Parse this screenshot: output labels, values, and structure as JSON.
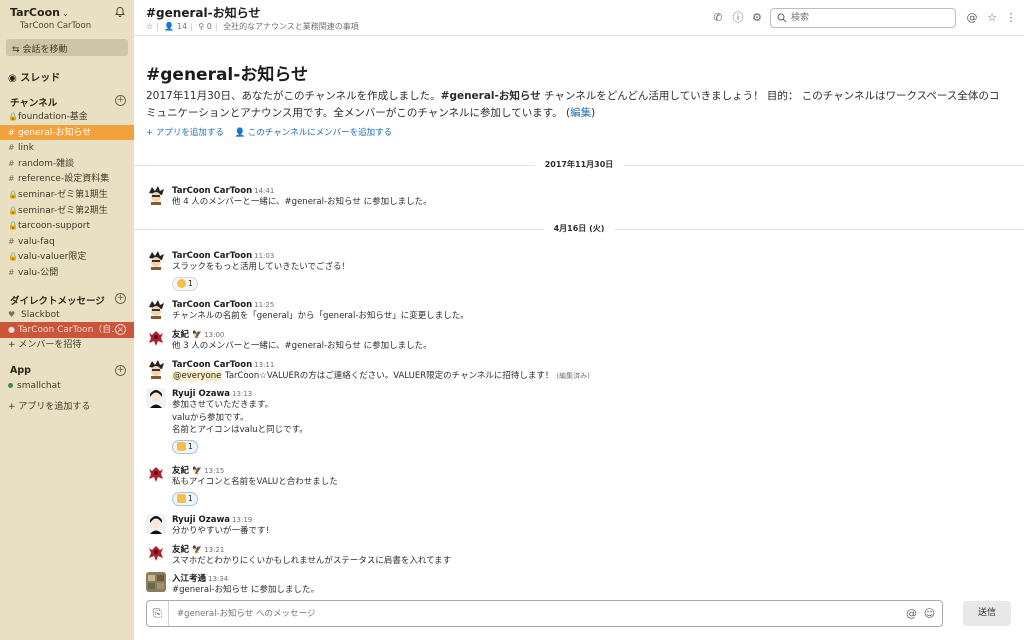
{
  "sidebar": {
    "team_name": "TarCoon",
    "team_user": "TarCoon CarToon",
    "jump_label": "会話を移動",
    "threads_label": "スレッド",
    "channels_heading": "チャンネル",
    "channels": [
      {
        "prefix": "🔒",
        "name": "foundation-基金"
      },
      {
        "prefix": "#",
        "name": "general-お知らせ"
      },
      {
        "prefix": "#",
        "name": "link"
      },
      {
        "prefix": "#",
        "name": "random-雑談"
      },
      {
        "prefix": "#",
        "name": "reference-設定資料集"
      },
      {
        "prefix": "🔒",
        "name": "seminar-ゼミ第1期生"
      },
      {
        "prefix": "🔒",
        "name": "seminar-ゼミ第2期生"
      },
      {
        "prefix": "🔒",
        "name": "tarcoon-support"
      },
      {
        "prefix": "#",
        "name": "valu-faq"
      },
      {
        "prefix": "🔒",
        "name": "valu-valuer限定"
      },
      {
        "prefix": "#",
        "name": "valu-公開"
      }
    ],
    "dm_heading": "ダイレクトメッセージ",
    "dms": [
      {
        "prefix": "♥",
        "name": "Slackbot"
      },
      {
        "prefix": "●",
        "name": "TarCoon CarToon（自..."
      }
    ],
    "invite_label": "+ メンバーを招待",
    "apps_heading": "App",
    "apps": [
      {
        "name": "smallchat"
      }
    ],
    "add_apps_label": "+ アプリを追加する"
  },
  "header": {
    "title": "#general-お知らせ",
    "member_count": "14",
    "pinned_count": "0",
    "topic": "全社的なアナウンスと業務関連の事項",
    "search_placeholder": "検索"
  },
  "intro": {
    "title": "#general-お知らせ",
    "text_1": "2017年11月30日、あなたがこのチャンネルを作成しました。",
    "channel_bold": "#general-お知らせ",
    "text_2": " チャンネルをどんどん活用していきましょう！ 目的： このチャンネルはワークスペース全体のコミュニケーションとアナウンス用です。全メンバーがこのチャンネルに参加しています。 (",
    "edit_link": "編集",
    "text_3": ")",
    "add_app": "+ アプリを追加する",
    "add_member": "このチャンネルにメンバーを追加する"
  },
  "dates": {
    "d1": "2017年11月30日",
    "d2": "4月16日 (火)"
  },
  "messages": {
    "m1": {
      "name": "TarCoon CarToon",
      "time": "14:41",
      "text": "他 4 人のメンバーと一緒に、#general-お知らせ に参加しました。"
    },
    "m2": {
      "name": "TarCoon CarToon",
      "time": "11:03",
      "text": "スラックをもっと活用していきたいでござる！",
      "reaction": "1"
    },
    "m3": {
      "name": "TarCoon CarToon",
      "time": "11:25",
      "text": "チャンネルの名前を「general」から「general-お知らせ」に変更しました。"
    },
    "m4": {
      "name": "友紀",
      "time": "13:00",
      "text": "他 3 人のメンバーと一緒に、#general-お知らせ に参加しました。"
    },
    "m5": {
      "name": "TarCoon CarToon",
      "time": "13:11",
      "mention": "@everyone",
      "text": " TarCoon☆VALUERの方はご連絡ください。VALUER限定のチャンネルに招待します！",
      "edited": "(編集済み)"
    },
    "m6": {
      "name": "Ryuji Ozawa",
      "time": "13:13",
      "line1": "参加させていただきます。",
      "line2": "valuから参加です。",
      "line3": "名前とアイコンはvaluと同じです。",
      "reaction": "1"
    },
    "m7": {
      "name": "友紀",
      "time": "13:15",
      "text": "私もアイコンと名前をVALUと合わせました",
      "reaction": "1"
    },
    "m8": {
      "name": "Ryuji Ozawa",
      "time": "13:19",
      "text": "分かりやすいが一番です！"
    },
    "m9": {
      "name": "友紀",
      "time": "13:21",
      "text": "スマホだとわかりにくいかもしれませんがステータスに肩書を入れてます"
    },
    "m10": {
      "name": "入江考通",
      "time": "13:34",
      "text": "#general-お知らせ に参加しました。"
    }
  },
  "composer": {
    "placeholder": "#general-お知らせ へのメッセージ",
    "send_label": "送信"
  },
  "colors": {
    "sidebar_bg": "#e9e0c4",
    "active_channel": "#f2a23c",
    "active_dm": "#c9553a",
    "link": "#1f6fb5"
  }
}
